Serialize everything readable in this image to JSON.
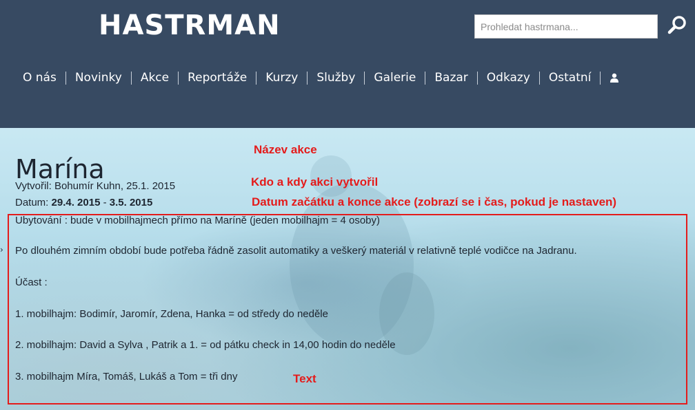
{
  "header": {
    "logo": "HASTRMAN",
    "search_placeholder": "Prohledat hastrmana...",
    "search_icon": "search-icon",
    "user_icon": "user-icon"
  },
  "nav": {
    "items": [
      "O nás",
      "Novinky",
      "Akce",
      "Reportáže",
      "Kurzy",
      "Služby",
      "Galerie",
      "Bazar",
      "Odkazy",
      "Ostatní"
    ]
  },
  "event": {
    "title": "Marína",
    "created_label": "Vytvořil: ",
    "created_value": "Bohumír Kuhn, 25.1. 2015",
    "date_label": "Datum: ",
    "date_start": "29.4. 2015",
    "date_sep": " - ",
    "date_end": "3.5. 2015",
    "lines": [
      "Ubytování : bude v mobilhajmech přímo na Maríně (jeden mobilhajm = 4 osoby)",
      "Po dlouhém zimním období bude potřeba řádně zasolit automatiky a veškerý materiál v relativně teplé vodičce na Jadranu.",
      "Účast :",
      "1. mobilhajm: Bodimír, Jaromír, Zdena, Hanka = od středy do neděle",
      "2. mobilhajm: David a Sylva , Patrik a 1. = od pátku check in 14,00 hodin do neděle",
      "3. mobilhajm Míra, Tomáš, Lukáš a Tom = tři dny"
    ]
  },
  "annotations": {
    "name": "Název akce",
    "creator": "Kdo a kdy akci vytvořil",
    "dates": "Datum začátku a konce akce (zobrazí se i čas, pokud je nastaven)",
    "text": "Text"
  },
  "colors": {
    "header_bg": "#374a62",
    "annotation_red": "#e41b1b"
  }
}
